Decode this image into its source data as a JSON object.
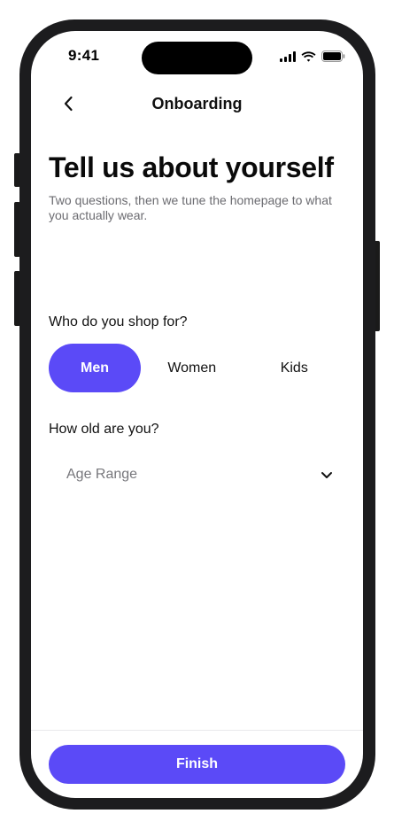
{
  "status_bar": {
    "time": "9:41",
    "icons": [
      "signal-icon",
      "wifi-icon",
      "battery-icon"
    ]
  },
  "nav": {
    "back_icon": "chevron-left-icon",
    "title": "Onboarding"
  },
  "header": {
    "title": "Tell us about yourself",
    "subtitle": "Two questions, then we tune the homepage to what you actually wear."
  },
  "shop_for": {
    "label": "Who do you shop for?",
    "options": [
      "Men",
      "Women",
      "Kids"
    ],
    "selected": "Men"
  },
  "age": {
    "label": "How old are you?",
    "placeholder": "Age Range",
    "icon": "chevron-down-icon"
  },
  "footer": {
    "finish_label": "Finish"
  },
  "colors": {
    "accent": "#5b4af7",
    "frame": "#1c1c1e",
    "muted_text": "#6b6b70"
  }
}
